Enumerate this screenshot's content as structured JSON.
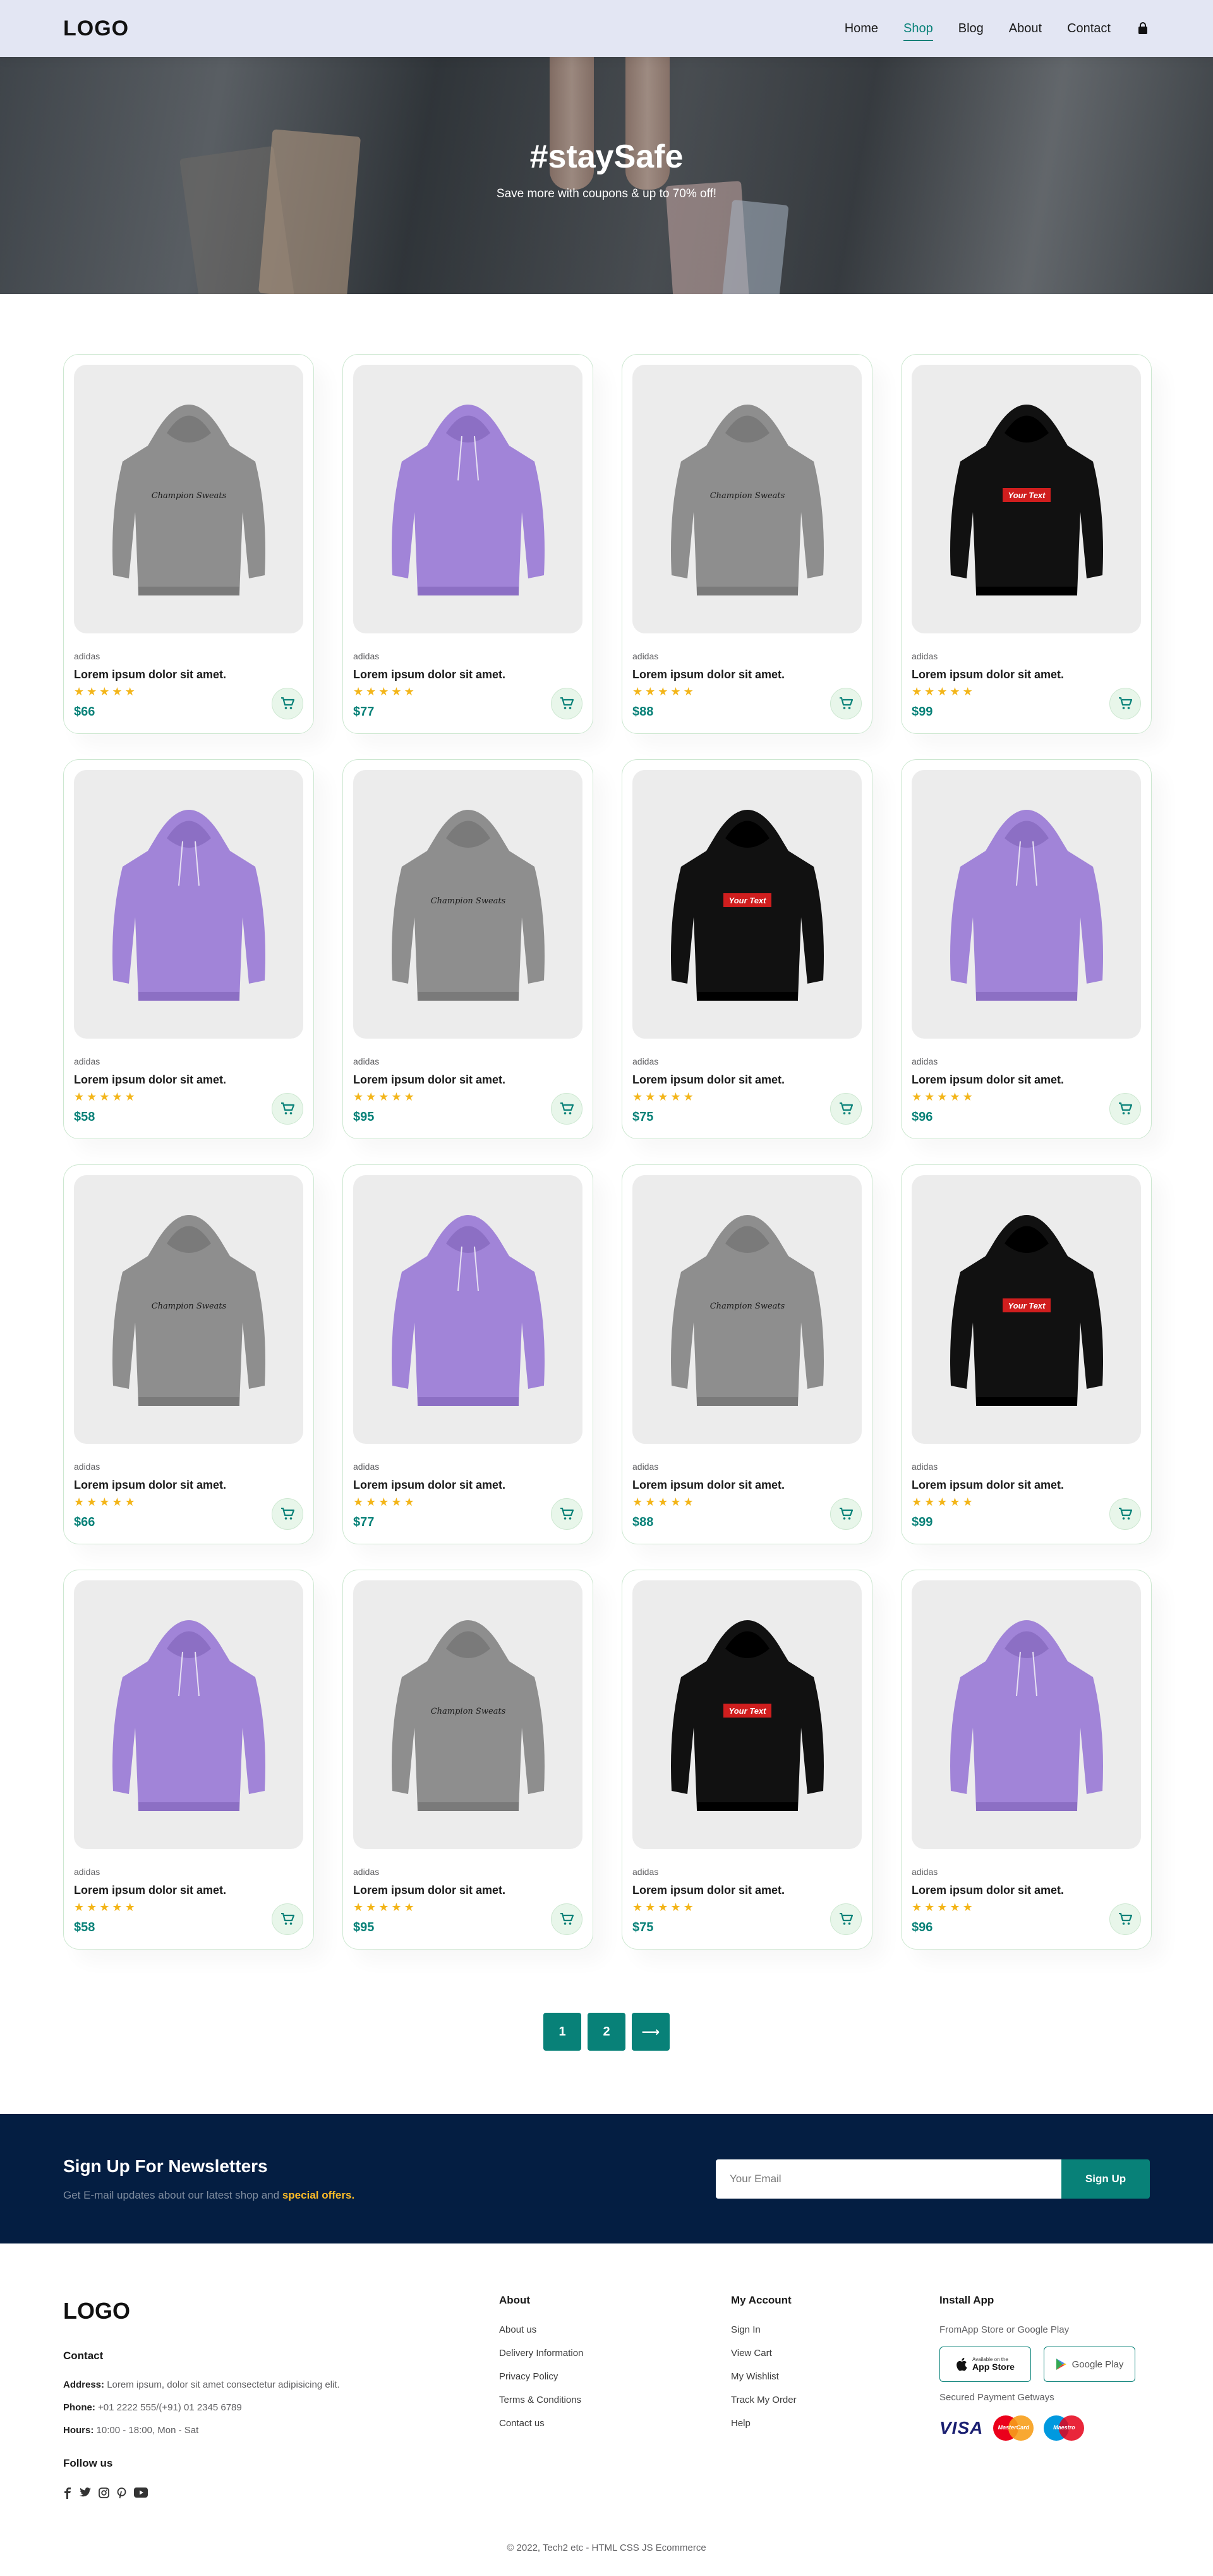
{
  "header": {
    "logo": "LOGO",
    "nav": [
      "Home",
      "Shop",
      "Blog",
      "About",
      "Contact"
    ],
    "active": "Shop",
    "bag_icon": "shopping-bag-icon"
  },
  "hero": {
    "title": "#staySafe",
    "subtitle": "Save more with coupons & up to 70% off!"
  },
  "products": [
    {
      "brand": "adidas",
      "title": "Lorem ipsum dolor sit amet.",
      "price": "$66",
      "color": "grey",
      "rating": 5
    },
    {
      "brand": "adidas",
      "title": "Lorem ipsum dolor sit amet.",
      "price": "$77",
      "color": "purple",
      "rating": 5
    },
    {
      "brand": "adidas",
      "title": "Lorem ipsum dolor sit amet.",
      "price": "$88",
      "color": "grey",
      "rating": 5
    },
    {
      "brand": "adidas",
      "title": "Lorem ipsum dolor sit amet.",
      "price": "$99",
      "color": "black",
      "rating": 5
    },
    {
      "brand": "adidas",
      "title": "Lorem ipsum dolor sit amet.",
      "price": "$58",
      "color": "purple",
      "rating": 5
    },
    {
      "brand": "adidas",
      "title": "Lorem ipsum dolor sit amet.",
      "price": "$95",
      "color": "grey",
      "rating": 5
    },
    {
      "brand": "adidas",
      "title": "Lorem ipsum dolor sit amet.",
      "price": "$75",
      "color": "black",
      "rating": 5
    },
    {
      "brand": "adidas",
      "title": "Lorem ipsum dolor sit amet.",
      "price": "$96",
      "color": "purple",
      "rating": 5
    },
    {
      "brand": "adidas",
      "title": "Lorem ipsum dolor sit amet.",
      "price": "$66",
      "color": "grey",
      "rating": 5
    },
    {
      "brand": "adidas",
      "title": "Lorem ipsum dolor sit amet.",
      "price": "$77",
      "color": "purple",
      "rating": 5
    },
    {
      "brand": "adidas",
      "title": "Lorem ipsum dolor sit amet.",
      "price": "$88",
      "color": "grey",
      "rating": 5
    },
    {
      "brand": "adidas",
      "title": "Lorem ipsum dolor sit amet.",
      "price": "$99",
      "color": "black",
      "rating": 5
    },
    {
      "brand": "adidas",
      "title": "Lorem ipsum dolor sit amet.",
      "price": "$58",
      "color": "purple",
      "rating": 5
    },
    {
      "brand": "adidas",
      "title": "Lorem ipsum dolor sit amet.",
      "price": "$95",
      "color": "grey",
      "rating": 5
    },
    {
      "brand": "adidas",
      "title": "Lorem ipsum dolor sit amet.",
      "price": "$75",
      "color": "black",
      "rating": 5
    },
    {
      "brand": "adidas",
      "title": "Lorem ipsum dolor sit amet.",
      "price": "$96",
      "color": "purple",
      "rating": 5
    }
  ],
  "print_texts": {
    "grey": "Champion Sweats",
    "black": "Your Text"
  },
  "pagination": {
    "pages": [
      "1",
      "2"
    ],
    "next": "⟶"
  },
  "newsletter": {
    "title": "Sign Up For Newsletters",
    "text": "Get E-mail updates about our latest shop and",
    "highlight": "special offers.",
    "placeholder": "Your Email",
    "button": "Sign Up"
  },
  "footer": {
    "logo": "LOGO",
    "contact_title": "Contact",
    "address_label": "Address:",
    "address": "Lorem ipsum, dolor sit amet consectetur adipisicing elit.",
    "phone_label": "Phone:",
    "phone": "+01 2222 555/(+91) 01 2345 6789",
    "hours_label": "Hours:",
    "hours": "10:00 - 18:00, Mon - Sat",
    "follow_title": "Follow us",
    "socials": [
      "facebook-icon",
      "twitter-icon",
      "instagram-icon",
      "pinterest-icon",
      "youtube-icon"
    ],
    "about_title": "About",
    "about_links": [
      "About us",
      "Delivery Information",
      "Privacy Policy",
      "Terms & Conditions",
      "Contact us"
    ],
    "account_title": "My Account",
    "account_links": [
      "Sign In",
      "View Cart",
      "My Wishlist",
      "Track My Order",
      "Help"
    ],
    "app_title": "Install App",
    "app_sub": "FromApp Store or Google Play",
    "app_store_small": "Available on the",
    "app_store": "App Store",
    "google_play": "Google Play",
    "secure": "Secured Payment Getways",
    "payments": [
      "VISA",
      "MasterCard",
      "Maestro"
    ],
    "copyright": "© 2022, Tech2 etc - HTML CSS JS Ecommerce"
  },
  "colors": {
    "accent": "#088178",
    "newsletter_bg": "#041e42",
    "star": "#f3b519",
    "highlight": "#ffbd27"
  }
}
